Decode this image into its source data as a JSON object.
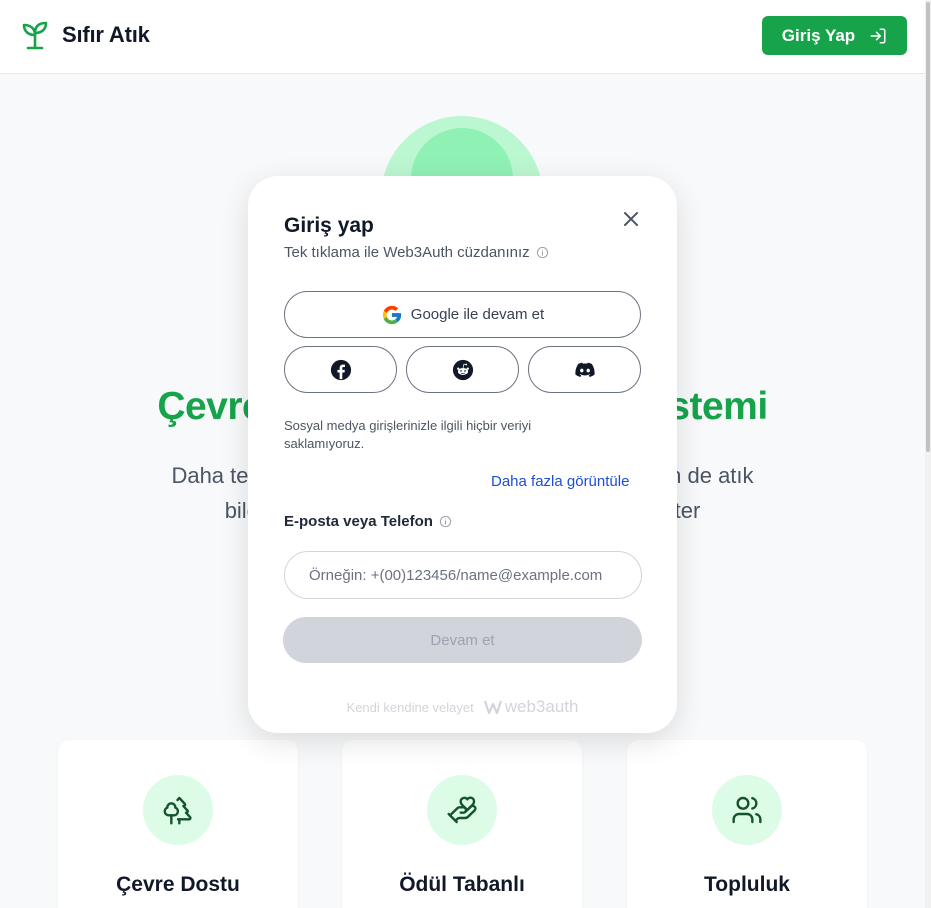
{
  "header": {
    "brand": "Sıfır Atık",
    "login_label": "Giriş Yap"
  },
  "hero": {
    "title": "Çevre Dostu Atık Yönetim Sistemi",
    "subtitle_line1": "Daha temiz bir dünya için sen de atık bildir! Peki sen de atık",
    "subtitle_line2": "bildirerek yardımcı olmak ve ödül kazanmak ister"
  },
  "cards": [
    {
      "title": "Çevre Dostu",
      "icon": "trees-icon"
    },
    {
      "title": "Ödül Tabanlı",
      "icon": "hand-reward-icon"
    },
    {
      "title": "Topluluk",
      "icon": "users-icon"
    }
  ],
  "modal": {
    "title": "Giriş yap",
    "subtitle": "Tek tıklama ile Web3Auth cüzdanınız",
    "google_label": "Google ile devam et",
    "social": [
      "facebook-icon",
      "reddit-icon",
      "discord-icon"
    ],
    "privacy_note": "Sosyal medya girişlerinizle ilgili hiçbir veriyi saklamıyoruz.",
    "more_link": "Daha fazla görüntüle",
    "field_label": "E-posta veya Telefon",
    "input_placeholder": "Örneğin: +(00)123456/name@example.com",
    "input_value": "",
    "continue_label": "Devam et",
    "footer_text": "Kendi kendine velayet",
    "footer_brand": "web3auth"
  },
  "colors": {
    "accent": "#16a34a",
    "link": "#1d4ed8",
    "disabled": "#d1d5db"
  }
}
